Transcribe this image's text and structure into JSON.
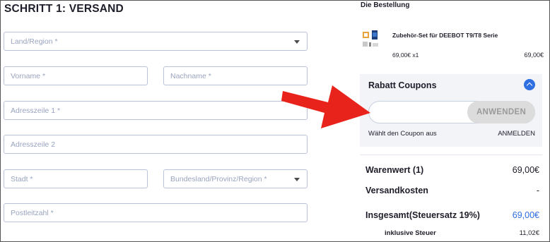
{
  "shipping": {
    "heading": "SCHRITT 1: VERSAND",
    "fields": {
      "country": "Land/Region *",
      "firstname": "Vorname *",
      "lastname": "Nachname *",
      "address1": "Adresszeile 1 *",
      "address2": "Adresszeile 2",
      "city": "Stadt *",
      "state": "Bundesland/Provinz/Region *",
      "zip": "Postleitzahl *"
    }
  },
  "order": {
    "title": "Die Bestellung",
    "product": {
      "name": "Zubehör-Set für DEEBOT T9/T8 Serie",
      "qty": "69,00€ x1",
      "price": "69,00€"
    }
  },
  "coupon": {
    "title": "Rabatt Coupons",
    "input_value": "",
    "apply_label": "ANWENDEN",
    "hint": "Wählt den Coupon aus",
    "login_label": "ANMELDEN"
  },
  "summary": {
    "subtotal_label": "Warenwert (1)",
    "subtotal_value": "69,00€",
    "shipping_label": "Versandkosten",
    "shipping_value": "-",
    "total_label": "Insgesamt(Steuersatz 19%)",
    "total_value": "69,00€",
    "tax_label": "inklusive Steuer",
    "tax_value": "11,02€"
  },
  "colors": {
    "accent": "#2f6fe0",
    "arrow": "#e8231b",
    "field_border": "#b9c3d9"
  },
  "icons": {
    "toggle": "chevron-up-icon",
    "dropdown": "chevron-down-icon"
  }
}
